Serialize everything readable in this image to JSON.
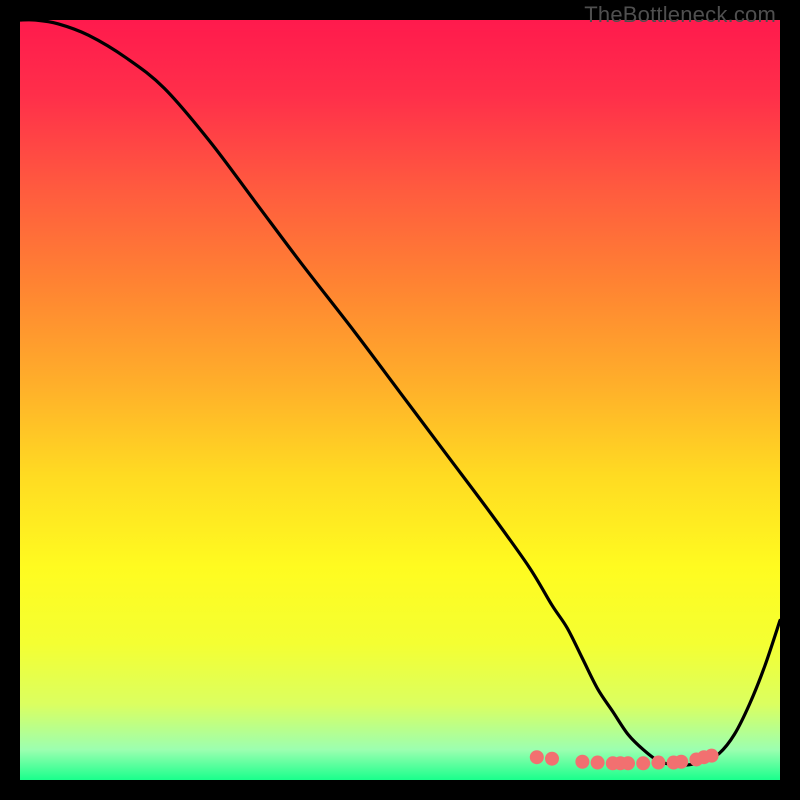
{
  "watermark": "TheBottleneck.com",
  "chart_data": {
    "type": "line",
    "title": "",
    "xlabel": "",
    "ylabel": "",
    "xlim": [
      0,
      100
    ],
    "ylim": [
      0,
      100
    ],
    "grid": false,
    "series": [
      {
        "name": "curve",
        "x": [
          0,
          2,
          5,
          9,
          14,
          19,
          25,
          31,
          37,
          44,
          50,
          56,
          62,
          67,
          70,
          72,
          74,
          76,
          78,
          80,
          82,
          84,
          86,
          88,
          90,
          92,
          94,
          96,
          98,
          100
        ],
        "y": [
          100,
          100,
          99.5,
          98,
          95,
          91,
          84,
          76,
          68,
          59,
          51,
          43,
          35,
          28,
          23,
          20,
          16,
          12,
          9,
          6,
          4,
          2.5,
          2,
          2,
          2.5,
          3.5,
          6,
          10,
          15,
          21
        ]
      },
      {
        "name": "markers",
        "x": [
          68,
          70,
          74,
          76,
          78,
          79,
          80,
          82,
          84,
          86,
          87,
          89,
          90,
          91
        ],
        "y": [
          3.0,
          2.8,
          2.4,
          2.3,
          2.2,
          2.2,
          2.2,
          2.2,
          2.3,
          2.3,
          2.4,
          2.7,
          3.0,
          3.2
        ]
      }
    ],
    "gradient_stops": [
      {
        "offset": 0.0,
        "color": "#ff1a4d"
      },
      {
        "offset": 0.1,
        "color": "#ff2f4a"
      },
      {
        "offset": 0.22,
        "color": "#ff5a3f"
      },
      {
        "offset": 0.35,
        "color": "#ff8432"
      },
      {
        "offset": 0.48,
        "color": "#ffaf2a"
      },
      {
        "offset": 0.6,
        "color": "#ffdb22"
      },
      {
        "offset": 0.72,
        "color": "#fffb20"
      },
      {
        "offset": 0.82,
        "color": "#f4ff32"
      },
      {
        "offset": 0.9,
        "color": "#dbff60"
      },
      {
        "offset": 0.96,
        "color": "#9cffb0"
      },
      {
        "offset": 1.0,
        "color": "#1aff8c"
      }
    ],
    "marker_color": "#f27070",
    "curve_color": "#000000"
  }
}
